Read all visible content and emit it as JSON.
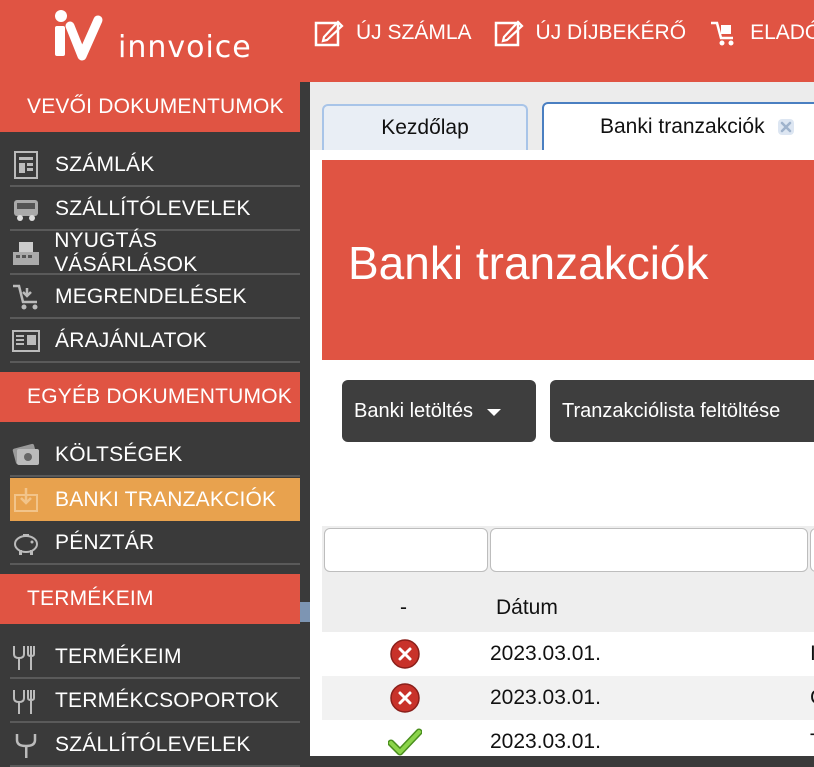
{
  "logo": {
    "text": "innvoice"
  },
  "topnav": [
    {
      "label": "ÚJ SZÁMLA",
      "icon": "edit-icon"
    },
    {
      "label": "ÚJ DÍJBEKÉRŐ",
      "icon": "edit-icon"
    },
    {
      "label": "ELADÓI",
      "icon": "cart-icon"
    }
  ],
  "sidebar": {
    "sections": [
      {
        "title": "VEVŐI DOKUMENTUMOK"
      },
      {
        "title": "EGYÉB DOKUMENTUMOK"
      },
      {
        "title": "TERMÉKEIM"
      }
    ],
    "items": [
      {
        "label": "SZÁMLÁK",
        "icon": "invoice-icon"
      },
      {
        "label": "SZÁLLÍTÓLEVELEK",
        "icon": "truck-icon"
      },
      {
        "label": "NYUGTÁS VÁSÁRLÁSOK",
        "icon": "register-icon"
      },
      {
        "label": "MEGRENDELÉSEK",
        "icon": "cart-icon"
      },
      {
        "label": "ÁRAJÁNLATOK",
        "icon": "quote-icon"
      },
      {
        "label": "KÖLTSÉGEK",
        "icon": "money-icon"
      },
      {
        "label": "BANKI TRANZAKCIÓK",
        "icon": "bank-icon"
      },
      {
        "label": "PÉNZTÁR",
        "icon": "piggy-bank-icon"
      },
      {
        "label": "TERMÉKEIM",
        "icon": "cutlery-icon"
      },
      {
        "label": "TERMÉKCSOPORTOK",
        "icon": "cutlery-icon"
      },
      {
        "label": "SZÁLLÍTÓLEVELEK",
        "icon": "fork-icon"
      }
    ],
    "active_item": "BANKI TRANZAKCIÓK"
  },
  "tabs": [
    {
      "label": "Kezdőlap"
    },
    {
      "label": "Banki tranzakciók"
    }
  ],
  "page": {
    "title": "Banki tranzakciók"
  },
  "toolbar": {
    "bank_download_label": "Banki letöltés",
    "upload_label": "Tranzakciólista feltöltése"
  },
  "table": {
    "headers": [
      "-",
      "Dátum"
    ],
    "rows": [
      {
        "status": "error",
        "status_icon": "error-icon",
        "date": "2023.03.01.",
        "next": "I"
      },
      {
        "status": "error",
        "status_icon": "error-icon",
        "date": "2023.03.01.",
        "next": "C"
      },
      {
        "status": "ok",
        "status_icon": "check-icon",
        "date": "2023.03.01.",
        "next": "T"
      }
    ]
  },
  "colors": {
    "brand_red": "#e05443",
    "sidebar_bg": "#3a3a3a",
    "active_orange": "#e8a24e",
    "button_dark": "#3e3e3e",
    "tab_border": "#4a7fc1"
  }
}
